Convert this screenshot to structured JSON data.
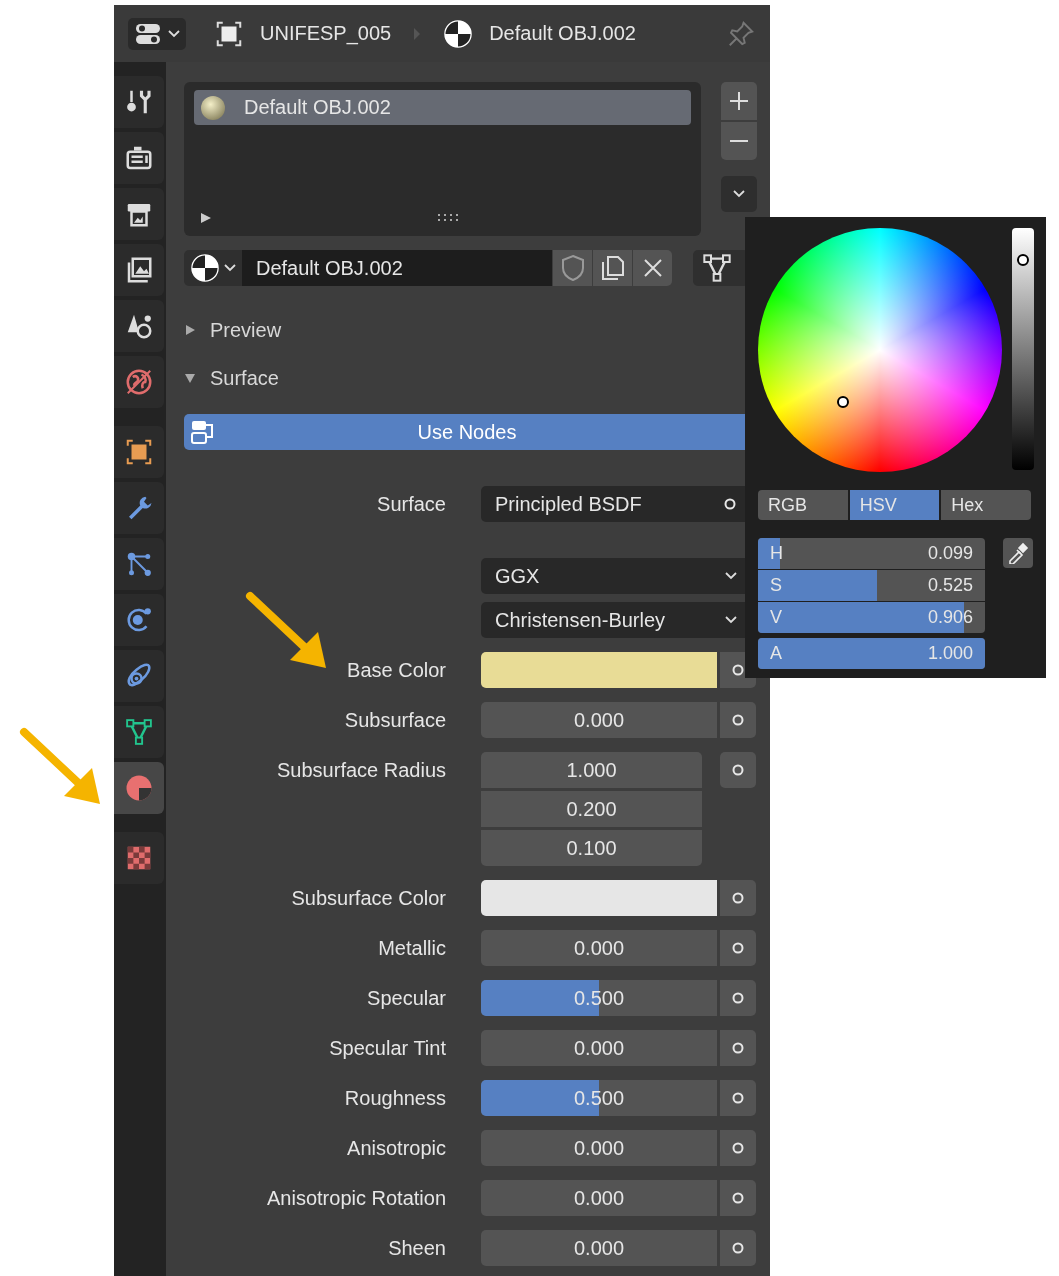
{
  "header": {
    "breadcrumbs": [
      {
        "kind": "object",
        "label": "UNIFESP_005"
      },
      {
        "kind": "material",
        "label": "Default OBJ.002"
      }
    ]
  },
  "tab_groups": [
    [
      {
        "kind": "tool",
        "selected": false
      },
      {
        "kind": "render",
        "selected": false
      },
      {
        "kind": "output",
        "selected": false
      },
      {
        "kind": "view_layer",
        "selected": false
      },
      {
        "kind": "scene",
        "selected": false
      },
      {
        "kind": "world",
        "selected": false
      }
    ],
    [
      {
        "kind": "object",
        "selected": false
      },
      {
        "kind": "modifiers",
        "selected": false
      },
      {
        "kind": "particles",
        "selected": false
      },
      {
        "kind": "physics",
        "selected": false
      },
      {
        "kind": "constraints",
        "selected": false
      },
      {
        "kind": "data",
        "selected": false
      },
      {
        "kind": "material",
        "selected": true
      }
    ],
    [
      {
        "kind": "texture",
        "selected": false
      }
    ]
  ],
  "material_slots": [
    {
      "label": "Default OBJ.002",
      "selected": true
    }
  ],
  "material_selector": {
    "name": "Default OBJ.002"
  },
  "panels": [
    {
      "label": "Preview",
      "expanded": false
    },
    {
      "label": "Surface",
      "expanded": true
    }
  ],
  "use_nodes_button": "Use Nodes",
  "properties": [
    {
      "kind": "dropdown",
      "label": "Surface",
      "value": "Principled BSDF",
      "socket": true
    },
    {
      "kind": "dropdown",
      "value": "GGX",
      "socket": false
    },
    {
      "kind": "dropdown",
      "value": "Christensen-Burley",
      "socket": false
    },
    {
      "kind": "color",
      "label": "Base Color",
      "color": "#e8dc96",
      "socket": true
    },
    {
      "kind": "slider",
      "label": "Subsurface",
      "value": "0.000",
      "level": 0,
      "socket": true
    },
    {
      "kind": "vector",
      "label": "Subsurface Radius",
      "values": [
        "1.000",
        "0.200",
        "0.100"
      ],
      "socket": true
    },
    {
      "kind": "color",
      "label": "Subsurface Color",
      "color": "#e6e6e6",
      "socket": true
    },
    {
      "kind": "slider",
      "label": "Metallic",
      "value": "0.000",
      "level": 0,
      "socket": true
    },
    {
      "kind": "slider",
      "label": "Specular",
      "value": "0.500",
      "level": 0.5,
      "socket": true
    },
    {
      "kind": "slider",
      "label": "Specular Tint",
      "value": "0.000",
      "level": 0,
      "socket": true
    },
    {
      "kind": "slider",
      "label": "Roughness",
      "value": "0.500",
      "level": 0.5,
      "socket": true
    },
    {
      "kind": "slider",
      "label": "Anisotropic",
      "value": "0.000",
      "level": 0,
      "socket": true
    },
    {
      "kind": "slider",
      "label": "Anisotropic Rotation",
      "value": "0.000",
      "level": 0,
      "socket": true
    },
    {
      "kind": "slider",
      "label": "Sheen",
      "value": "0.000",
      "level": 0,
      "socket": true
    }
  ],
  "color_picker": {
    "tabs": [
      {
        "label": "RGB",
        "selected": false
      },
      {
        "label": "HSV",
        "selected": true
      },
      {
        "label": "Hex",
        "selected": false
      }
    ],
    "sliders": [
      {
        "label": "H",
        "value": "0.099",
        "level": 0.099
      },
      {
        "label": "S",
        "value": "0.525",
        "level": 0.525
      },
      {
        "label": "V",
        "value": "0.906",
        "level": 0.906
      },
      {
        "label": "A",
        "value": "1.000",
        "level": 1.0
      }
    ]
  }
}
